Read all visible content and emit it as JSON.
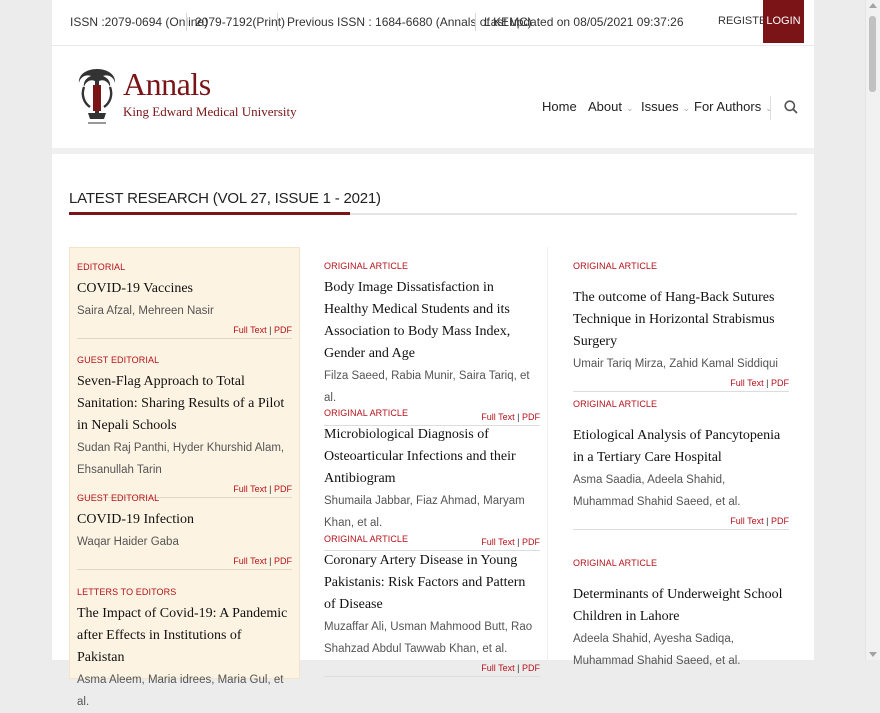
{
  "topbar": {
    "issn_online": "ISSN :2079-0694 (Online)",
    "issn_print": "2079-7192(Print)",
    "previous_issn": "Previous ISSN : 1684-6680 (Annals of KEMC)",
    "last_updated": "Last updated on 08/05/2021 09:37:26",
    "register_label": "REGISTER",
    "login_label": "LOGIN"
  },
  "brand": {
    "title": "Annals",
    "subtitle": "King Edward Medical University"
  },
  "nav": {
    "home": "Home",
    "about": "About",
    "issues": "Issues",
    "for_authors": "For Authors",
    "chevron": "⌄"
  },
  "section": {
    "title": "LATEST RESEARCH (VOL 27, ISSUE 1 - 2021)"
  },
  "links": {
    "full_text": "Full Text",
    "sep": "|",
    "pdf": "PDF"
  },
  "columns": {
    "left": [
      {
        "category": "EDITORIAL",
        "title": "COVID-19 Vaccines",
        "authors": "Saira Afzal, Mehreen Nasir"
      },
      {
        "category": "GUEST EDITORIAL",
        "title": "Seven-Flag Approach to Total Sanitation: Sharing Results of a Pilot in Nepali Schools",
        "authors": "Sudan Raj Panthi, Hyder Khurshid Alam, Ehsanullah Tarin"
      },
      {
        "category": "GUEST EDITORIAL",
        "title": "COVID-19 Infection",
        "authors": "Waqar Haider Gaba"
      },
      {
        "category": "LETTERS TO EDITORS",
        "title": "The Impact of Covid-19: A Pandemic after Effects in Institutions of Pakistan",
        "authors": "Asma Aleem, Maria idrees, Maria Gul, et al."
      }
    ],
    "middle": [
      {
        "category": "ORIGINAL ARTICLE",
        "title": "Body Image Dissatisfaction in Healthy Medical Students and its Association to Body Mass Index, Gender and Age",
        "authors": "Filza Saeed, Rabia Munir, Saira Tariq, et al."
      },
      {
        "category": "ORIGINAL ARTICLE",
        "title": "Microbiological Diagnosis of Osteoarticular Infections and their Antibiogram",
        "authors": "Shumaila Jabbar, Fiaz Ahmad, Maryam Khan, et al."
      },
      {
        "category": "ORIGINAL ARTICLE",
        "title": "Coronary Artery Disease in Young Pakistanis: Risk Factors and Pattern of Disease",
        "authors": "Muzaffar Ali, Usman Mahmood Butt, Rao Shahzad Abdul Tawwab Khan, et al."
      }
    ],
    "right": [
      {
        "category": "ORIGINAL ARTICLE",
        "title": "The outcome of Hang-Back Sutures Technique in Horizontal Strabismus Surgery",
        "authors": "Umair Tariq Mirza, Zahid Kamal Siddiqui"
      },
      {
        "category": "ORIGINAL ARTICLE",
        "title": "Etiological Analysis of Pancytopenia in a Tertiary Care Hospital",
        "authors": "Asma Saadia, Adeela Shahid, Muhammad Shahid Saeed, et al."
      },
      {
        "category": "ORIGINAL ARTICLE",
        "title": "Determinants of Underweight School Children in Lahore",
        "authors": "Adeela Shahid, Ayesha Sadiqa, Muhammad Shahid Saeed, et al."
      }
    ]
  },
  "colors": {
    "brand": "#7a1416",
    "accent_red": "#b5121b",
    "editorial_bg": "#fdf3e2"
  },
  "icons": {
    "search": "search-icon",
    "logo": "kemu-logo-icon"
  }
}
